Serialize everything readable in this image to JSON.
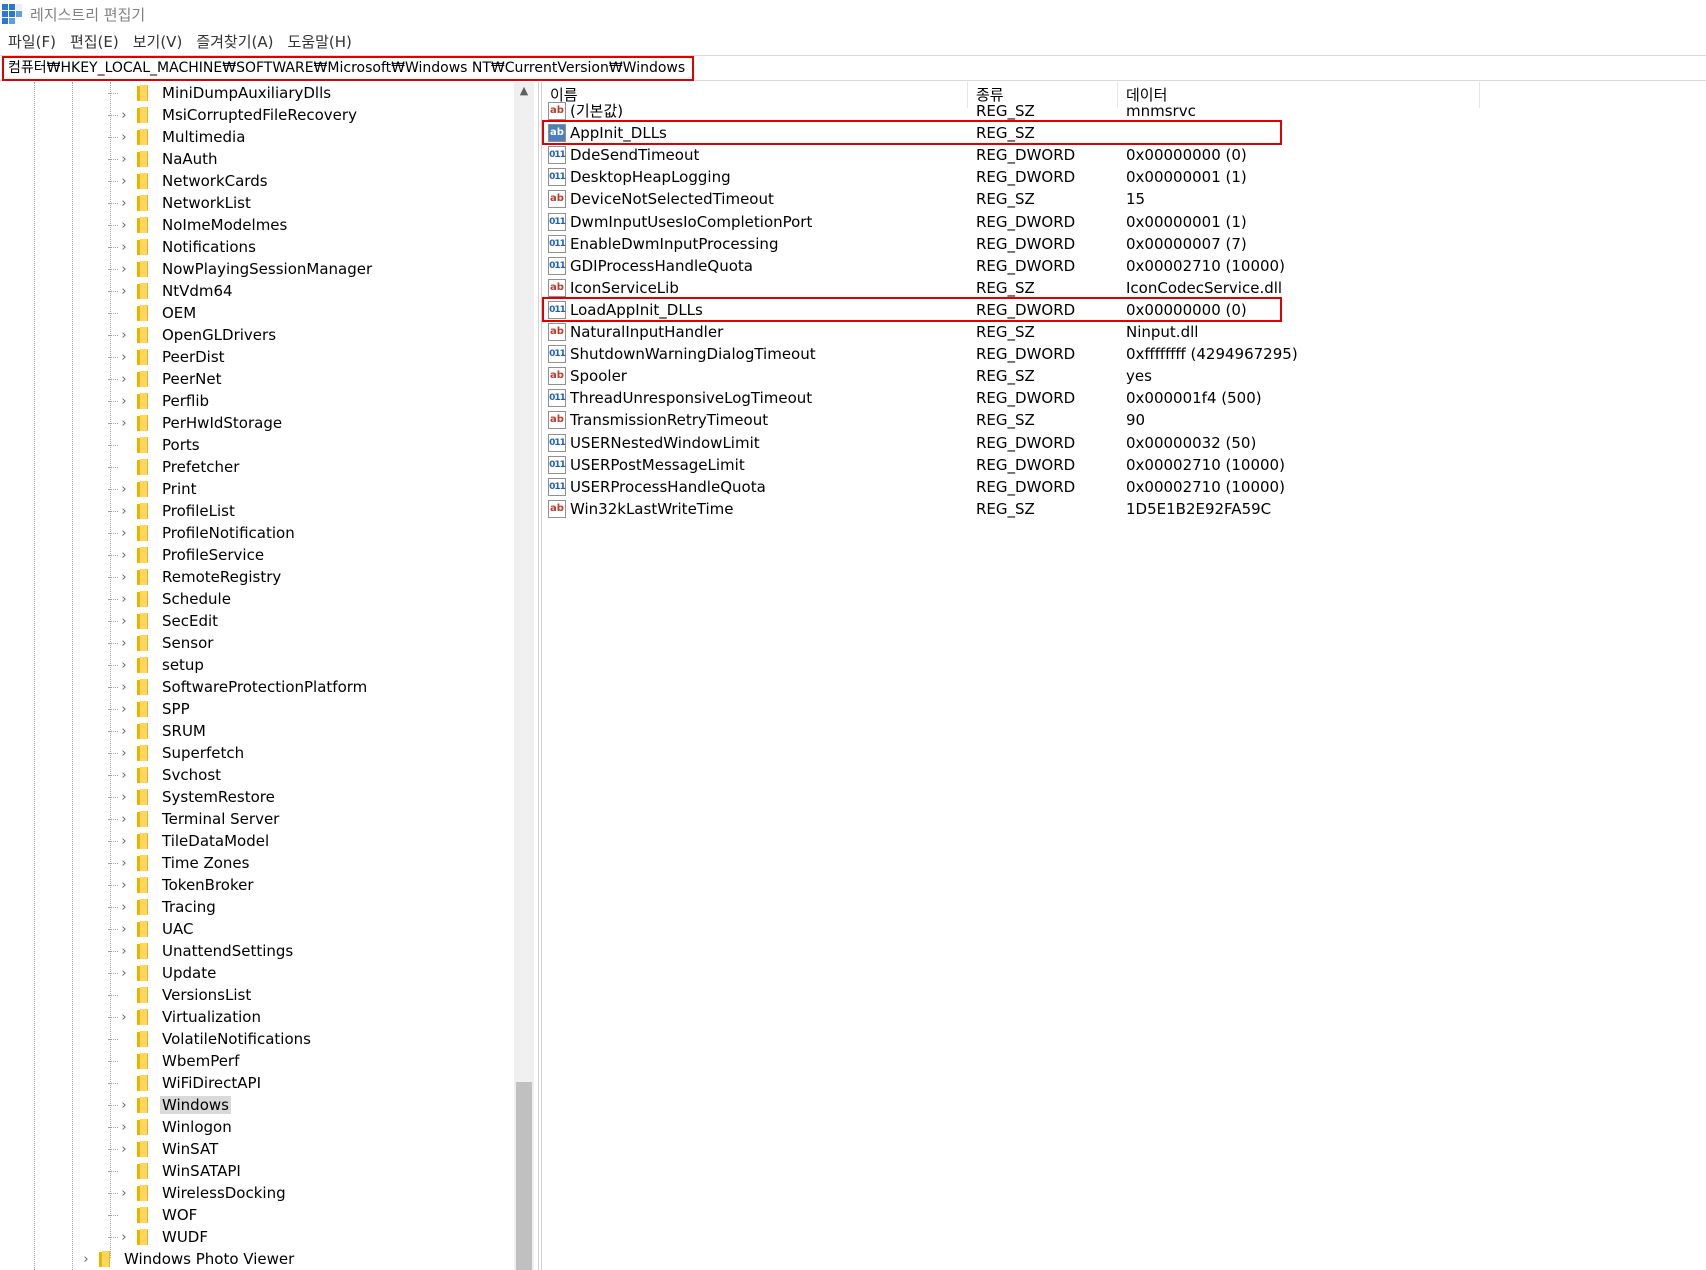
{
  "window": {
    "title": "레지스트리 편집기"
  },
  "menu": [
    "파일(F)",
    "편집(E)",
    "보기(V)",
    "즐겨찾기(A)",
    "도움말(H)"
  ],
  "address": {
    "path": "컴퓨터₩HKEY_LOCAL_MACHINE₩SOFTWARE₩Microsoft₩Windows NT₩CurrentVersion₩Windows"
  },
  "tree": {
    "items": [
      {
        "label": "MiniDumpAuxiliaryDlls",
        "expandable": false
      },
      {
        "label": "MsiCorruptedFileRecovery",
        "expandable": true
      },
      {
        "label": "Multimedia",
        "expandable": true
      },
      {
        "label": "NaAuth",
        "expandable": true
      },
      {
        "label": "NetworkCards",
        "expandable": true
      },
      {
        "label": "NetworkList",
        "expandable": true
      },
      {
        "label": "NoImeModelmes",
        "expandable": true
      },
      {
        "label": "Notifications",
        "expandable": true
      },
      {
        "label": "NowPlayingSessionManager",
        "expandable": true
      },
      {
        "label": "NtVdm64",
        "expandable": true
      },
      {
        "label": "OEM",
        "expandable": false
      },
      {
        "label": "OpenGLDrivers",
        "expandable": true
      },
      {
        "label": "PeerDist",
        "expandable": true
      },
      {
        "label": "PeerNet",
        "expandable": true
      },
      {
        "label": "Perflib",
        "expandable": true
      },
      {
        "label": "PerHwIdStorage",
        "expandable": true
      },
      {
        "label": "Ports",
        "expandable": false
      },
      {
        "label": "Prefetcher",
        "expandable": false
      },
      {
        "label": "Print",
        "expandable": true
      },
      {
        "label": "ProfileList",
        "expandable": true
      },
      {
        "label": "ProfileNotification",
        "expandable": true
      },
      {
        "label": "ProfileService",
        "expandable": true
      },
      {
        "label": "RemoteRegistry",
        "expandable": true
      },
      {
        "label": "Schedule",
        "expandable": true
      },
      {
        "label": "SecEdit",
        "expandable": true
      },
      {
        "label": "Sensor",
        "expandable": true
      },
      {
        "label": "setup",
        "expandable": true
      },
      {
        "label": "SoftwareProtectionPlatform",
        "expandable": true
      },
      {
        "label": "SPP",
        "expandable": true
      },
      {
        "label": "SRUM",
        "expandable": true
      },
      {
        "label": "Superfetch",
        "expandable": true
      },
      {
        "label": "Svchost",
        "expandable": true
      },
      {
        "label": "SystemRestore",
        "expandable": true
      },
      {
        "label": "Terminal Server",
        "expandable": true
      },
      {
        "label": "TileDataModel",
        "expandable": true
      },
      {
        "label": "Time Zones",
        "expandable": true
      },
      {
        "label": "TokenBroker",
        "expandable": true
      },
      {
        "label": "Tracing",
        "expandable": true
      },
      {
        "label": "UAC",
        "expandable": true
      },
      {
        "label": "UnattendSettings",
        "expandable": true
      },
      {
        "label": "Update",
        "expandable": true
      },
      {
        "label": "VersionsList",
        "expandable": false
      },
      {
        "label": "Virtualization",
        "expandable": true
      },
      {
        "label": "VolatileNotifications",
        "expandable": false
      },
      {
        "label": "WbemPerf",
        "expandable": false
      },
      {
        "label": "WiFiDirectAPI",
        "expandable": false
      },
      {
        "label": "Windows",
        "expandable": true,
        "selected": true
      },
      {
        "label": "Winlogon",
        "expandable": true
      },
      {
        "label": "WinSAT",
        "expandable": true
      },
      {
        "label": "WinSATAPI",
        "expandable": false
      },
      {
        "label": "WirelessDocking",
        "expandable": true
      },
      {
        "label": "WOF",
        "expandable": false
      },
      {
        "label": "WUDF",
        "expandable": true
      }
    ],
    "parent_sibling": {
      "label": "Windows Photo Viewer",
      "expandable": true
    }
  },
  "list": {
    "columns": [
      "이름",
      "종류",
      "데이터"
    ],
    "rows": [
      {
        "name": "(기본값)",
        "type": "REG_SZ",
        "data": "mnmsrvc",
        "icon": "sz"
      },
      {
        "name": "AppInit_DLLs",
        "type": "REG_SZ",
        "data": "",
        "icon": "sz",
        "highlighted": true,
        "icon_selected": true
      },
      {
        "name": "DdeSendTimeout",
        "type": "REG_DWORD",
        "data": "0x00000000 (0)",
        "icon": "dword"
      },
      {
        "name": "DesktopHeapLogging",
        "type": "REG_DWORD",
        "data": "0x00000001 (1)",
        "icon": "dword"
      },
      {
        "name": "DeviceNotSelectedTimeout",
        "type": "REG_SZ",
        "data": "15",
        "icon": "sz"
      },
      {
        "name": "DwmInputUsesIoCompletionPort",
        "type": "REG_DWORD",
        "data": "0x00000001 (1)",
        "icon": "dword"
      },
      {
        "name": "EnableDwmInputProcessing",
        "type": "REG_DWORD",
        "data": "0x00000007 (7)",
        "icon": "dword"
      },
      {
        "name": "GDIProcessHandleQuota",
        "type": "REG_DWORD",
        "data": "0x00002710 (10000)",
        "icon": "dword"
      },
      {
        "name": "IconServiceLib",
        "type": "REG_SZ",
        "data": "IconCodecService.dll",
        "icon": "sz"
      },
      {
        "name": "LoadAppInit_DLLs",
        "type": "REG_DWORD",
        "data": "0x00000000 (0)",
        "icon": "dword",
        "highlighted": true
      },
      {
        "name": "NaturalInputHandler",
        "type": "REG_SZ",
        "data": "Ninput.dll",
        "icon": "sz"
      },
      {
        "name": "ShutdownWarningDialogTimeout",
        "type": "REG_DWORD",
        "data": "0xffffffff (4294967295)",
        "icon": "dword"
      },
      {
        "name": "Spooler",
        "type": "REG_SZ",
        "data": "yes",
        "icon": "sz"
      },
      {
        "name": "ThreadUnresponsiveLogTimeout",
        "type": "REG_DWORD",
        "data": "0x000001f4 (500)",
        "icon": "dword"
      },
      {
        "name": "TransmissionRetryTimeout",
        "type": "REG_SZ",
        "data": "90",
        "icon": "sz"
      },
      {
        "name": "USERNestedWindowLimit",
        "type": "REG_DWORD",
        "data": "0x00000032 (50)",
        "icon": "dword"
      },
      {
        "name": "USERPostMessageLimit",
        "type": "REG_DWORD",
        "data": "0x00002710 (10000)",
        "icon": "dword"
      },
      {
        "name": "USERProcessHandleQuota",
        "type": "REG_DWORD",
        "data": "0x00002710 (10000)",
        "icon": "dword"
      },
      {
        "name": "Win32kLastWriteTime",
        "type": "REG_SZ",
        "data": "1D5E1B2E92FA59C",
        "icon": "sz"
      }
    ]
  },
  "icons": {
    "sz": "ab",
    "dword": "011"
  },
  "colors": {
    "highlight": "#e00000",
    "folder": "#ffd65c",
    "selected_bg": "#d9d9d9"
  }
}
